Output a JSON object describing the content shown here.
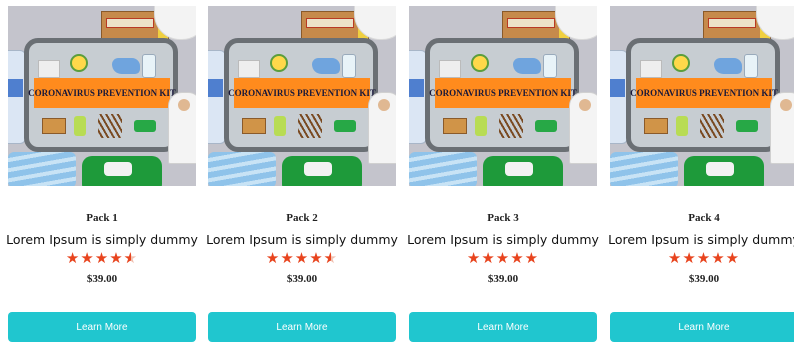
{
  "theme": {
    "button_color": "#20c6cf",
    "star_color": "#e8441e",
    "banner_color": "#ff8b1d"
  },
  "products": [
    {
      "image_banner": "CORONAVIRUS PREVENTION KIT",
      "title": "Pack 1",
      "description": "Lorem Ipsum is simply dummy",
      "rating": 4.5,
      "price": "$39.00",
      "button_label": "Learn More"
    },
    {
      "image_banner": "CORONAVIRUS PREVENTION KIT",
      "title": "Pack 2",
      "description": "Lorem Ipsum is simply dummy",
      "rating": 4.5,
      "price": "$39.00",
      "button_label": "Learn More"
    },
    {
      "image_banner": "CORONAVIRUS PREVENTION KIT",
      "title": "Pack 3",
      "description": "Lorem Ipsum is simply dummy",
      "rating": 5,
      "price": "$39.00",
      "button_label": "Learn More"
    },
    {
      "image_banner": "CORONAVIRUS PREVENTION KIT",
      "title": "Pack 4",
      "description": "Lorem Ipsum is simply dummy",
      "rating": 5,
      "price": "$39.00",
      "button_label": "Learn More"
    }
  ]
}
